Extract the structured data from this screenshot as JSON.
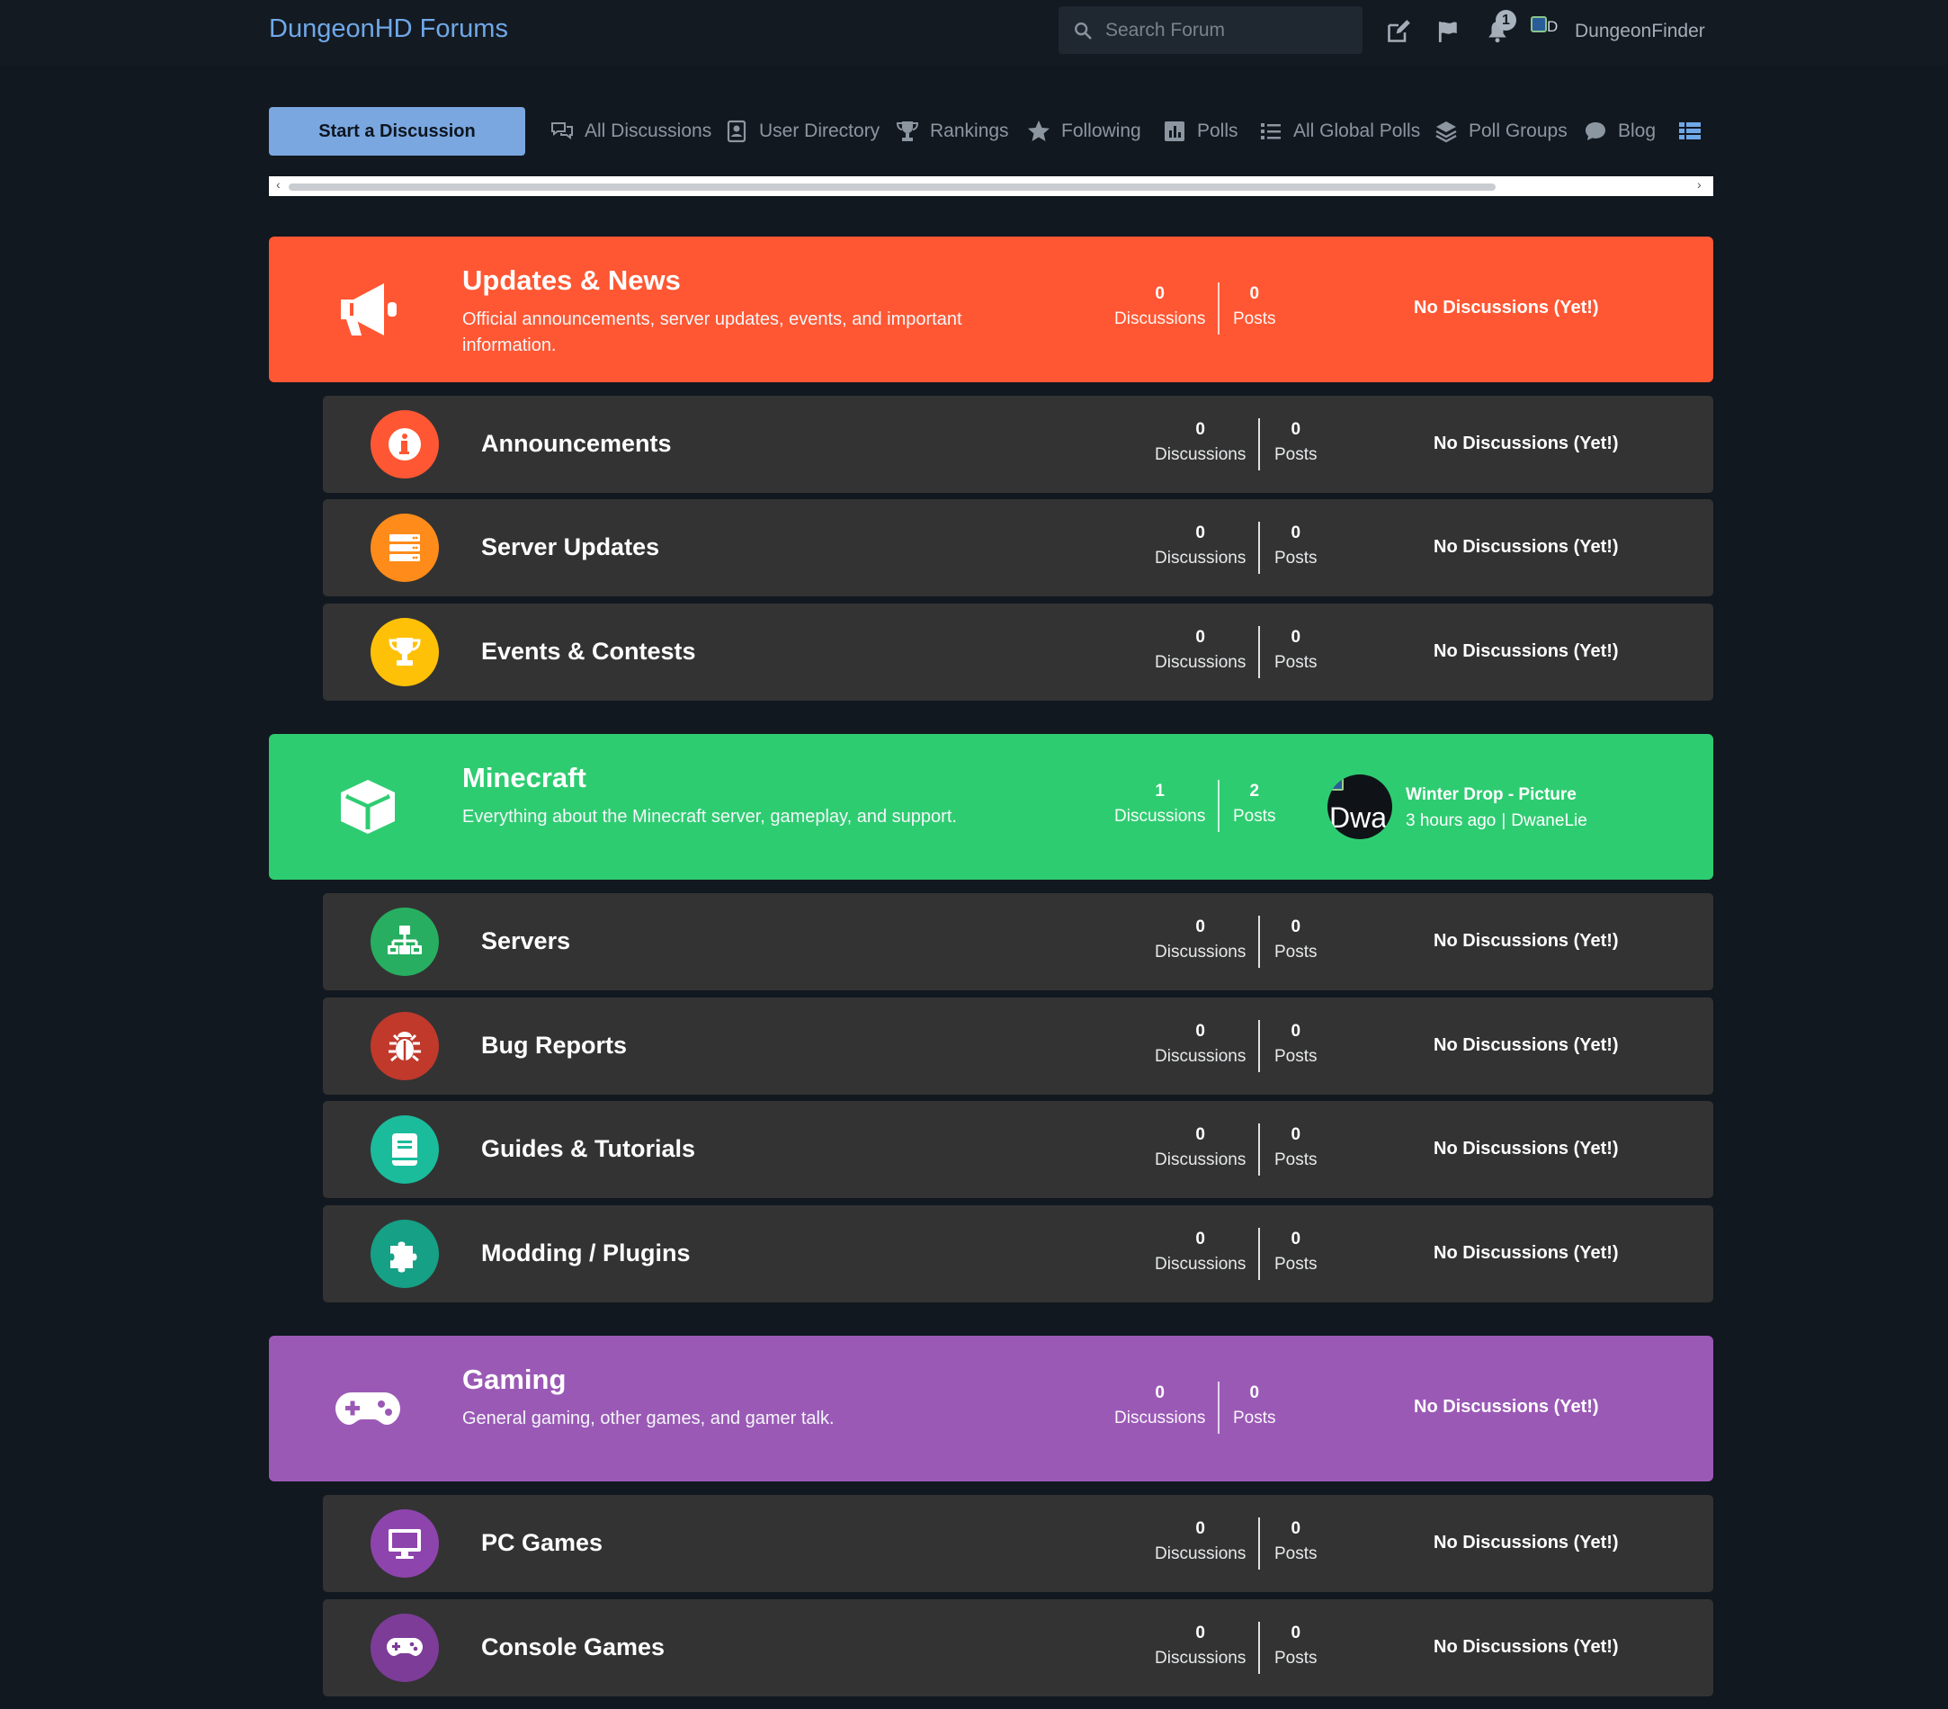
{
  "header": {
    "brand": "DungeonHD Forums",
    "search_placeholder": "Search Forum",
    "notification_count": "1",
    "avatar_alt_text": "D",
    "username": "DungeonFinder"
  },
  "nav": {
    "start_button": "Start a Discussion",
    "items": [
      {
        "label": "All Discussions",
        "icon": "comments-icon"
      },
      {
        "label": "User Directory",
        "icon": "address-book-icon"
      },
      {
        "label": "Rankings",
        "icon": "trophy-icon"
      },
      {
        "label": "Following",
        "icon": "star-icon"
      },
      {
        "label": "Polls",
        "icon": "poll-icon"
      },
      {
        "label": "All Global Polls",
        "icon": "list-icon"
      },
      {
        "label": "Poll Groups",
        "icon": "layers-icon"
      },
      {
        "label": "Blog",
        "icon": "comment-icon"
      }
    ],
    "view_toggle_icon": "list-view-icon"
  },
  "stat_labels": {
    "discussions": "Discussions",
    "posts": "Posts"
  },
  "no_discussions": "No Discussions (Yet!)",
  "categories": [
    {
      "title": "Updates & News",
      "description": "Official announcements, server updates, events, and important information.",
      "color": "#ff5733",
      "icon": "megaphone-icon",
      "discussions": "0",
      "posts": "0",
      "subs": [
        {
          "title": "Announcements",
          "icon": "info-icon",
          "color": "#ff5733",
          "discussions": "0",
          "posts": "0"
        },
        {
          "title": "Server Updates",
          "icon": "server-icon",
          "color": "#ff8c1a",
          "discussions": "0",
          "posts": "0"
        },
        {
          "title": "Events & Contests",
          "icon": "trophy-icon",
          "color": "#ffc107",
          "discussions": "0",
          "posts": "0"
        }
      ]
    },
    {
      "title": "Minecraft",
      "description": "Everything about the Minecraft server, gameplay, and support.",
      "color": "#2ecc71",
      "icon": "cube-icon",
      "discussions": "1",
      "posts": "2",
      "last_post": {
        "title": "Winter Drop - Picture",
        "time": "3 hours ago",
        "sep": "|",
        "author": "DwaneLie",
        "avatar_text": "Dwa"
      },
      "subs": [
        {
          "title": "Servers",
          "icon": "network-icon",
          "color": "#27ae60",
          "discussions": "0",
          "posts": "0"
        },
        {
          "title": "Bug Reports",
          "icon": "bug-icon",
          "color": "#c0392b",
          "discussions": "0",
          "posts": "0"
        },
        {
          "title": "Guides & Tutorials",
          "icon": "book-icon",
          "color": "#1abc9c",
          "discussions": "0",
          "posts": "0"
        },
        {
          "title": "Modding / Plugins",
          "icon": "puzzle-icon",
          "color": "#16a085",
          "discussions": "0",
          "posts": "0"
        }
      ]
    },
    {
      "title": "Gaming",
      "description": "General gaming, other games, and gamer talk.",
      "color": "#9b59b6",
      "icon": "gamepad-icon",
      "discussions": "0",
      "posts": "0",
      "subs": [
        {
          "title": "PC Games",
          "icon": "desktop-icon",
          "color": "#8e44ad",
          "discussions": "0",
          "posts": "0"
        },
        {
          "title": "Console Games",
          "icon": "gamepad-icon",
          "color": "#7d3c98",
          "discussions": "0",
          "posts": "0"
        }
      ]
    }
  ]
}
